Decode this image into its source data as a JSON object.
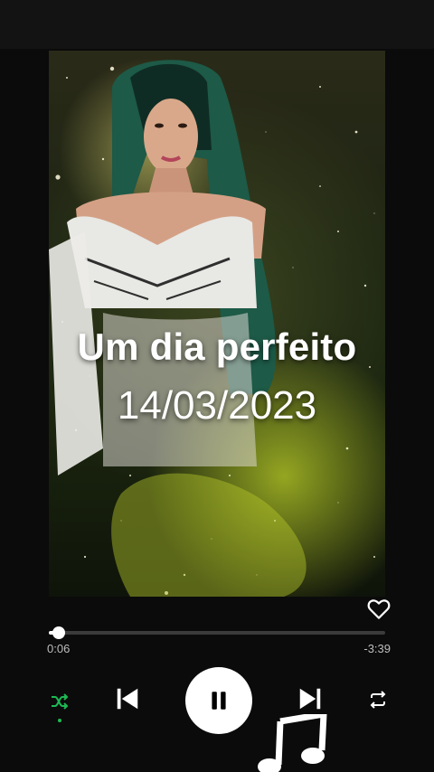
{
  "artwork": {
    "title_overlay": "Um dia perfeito",
    "date_overlay": "14/03/2023"
  },
  "player": {
    "progress_fraction": 0.03,
    "elapsed": "0:06",
    "remaining": "-3:39",
    "liked": false,
    "shuffle_active": true
  },
  "icons": {
    "like": "heart-outline-icon",
    "shuffle": "shuffle-icon",
    "previous": "skip-previous-icon",
    "play_pause": "pause-icon",
    "next": "skip-next-icon",
    "repeat": "repeat-icon",
    "overlay": "music-note-icon"
  },
  "colors": {
    "background": "#0b0b0b",
    "accent": "#1db954",
    "text_secondary": "#bdbdbd"
  }
}
